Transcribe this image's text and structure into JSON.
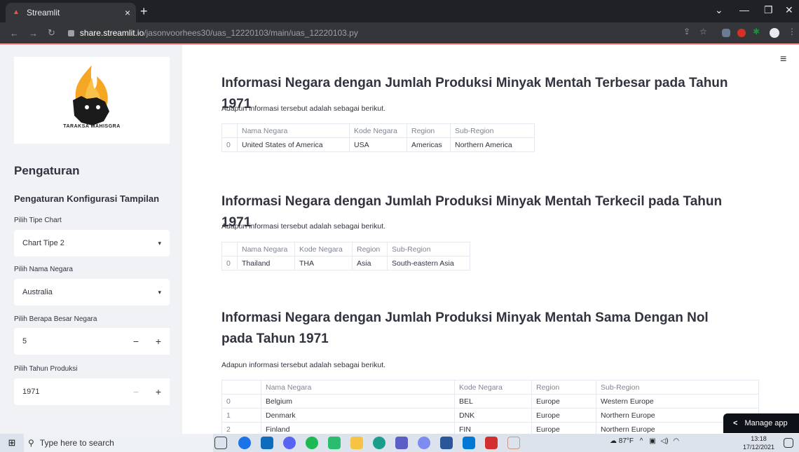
{
  "browser": {
    "tab_title": "Streamlit",
    "tab_close": "×",
    "new_tab": "+",
    "url_host": "share.streamlit.io",
    "url_path": "/jasonvoorhees30/uas_12220103/main/uas_12220103.py",
    "win_min": "—",
    "win_max": "❐",
    "win_close": "✕",
    "win_dropdown": "⌄"
  },
  "sidebar": {
    "logo_caption": "TARAKSA MAHISGRA",
    "heading": "Pengaturan",
    "subheading": "Pengaturan Konfigurasi Tampilan",
    "chart_type": {
      "label": "Pilih Tipe Chart",
      "value": "Chart Tipe 2"
    },
    "country": {
      "label": "Pilih Nama Negara",
      "value": "Australia"
    },
    "size": {
      "label": "Pilih Berapa Besar Negara",
      "value": "5",
      "minus": "−",
      "plus": "+"
    },
    "year": {
      "label": "Pilih Tahun Produksi",
      "value": "1971",
      "minus": "−",
      "plus": "+"
    }
  },
  "main": {
    "sections": [
      {
        "title": "Informasi Negara dengan Jumlah Produksi Minyak Mentah Terbesar pada Tahun 1971",
        "intro": "Adapun informasi tersebut adalah sebagai berikut.",
        "columns": [
          "",
          "Nama Negara",
          "Kode Negara",
          "Region",
          "Sub-Region"
        ],
        "rows": [
          [
            "0",
            "United States of America",
            "USA",
            "Americas",
            "Northern America"
          ]
        ]
      },
      {
        "title": "Informasi Negara dengan Jumlah Produksi Minyak Mentah Terkecil pada Tahun 1971",
        "intro": "Adapun informasi tersebut adalah sebagai berikut.",
        "columns": [
          "",
          "Nama Negara",
          "Kode Negara",
          "Region",
          "Sub-Region"
        ],
        "rows": [
          [
            "0",
            "Thailand",
            "THA",
            "Asia",
            "South-eastern Asia"
          ]
        ]
      },
      {
        "title": "Informasi Negara dengan Jumlah Produksi Minyak Mentah Sama Dengan Nol pada Tahun 1971",
        "intro": "Adapun informasi tersebut adalah sebagai berikut.",
        "columns": [
          "",
          "Nama Negara",
          "Kode Negara",
          "Region",
          "Sub-Region"
        ],
        "rows": [
          [
            "0",
            "Belgium",
            "BEL",
            "Europe",
            "Western Europe"
          ],
          [
            "1",
            "Denmark",
            "DNK",
            "Europe",
            "Northern Europe"
          ],
          [
            "2",
            "Finland",
            "FIN",
            "Europe",
            "Northern Europe"
          ]
        ]
      }
    ],
    "manage_app": "Manage app",
    "manage_chevron": "<"
  },
  "taskbar": {
    "search_placeholder": "Type here to search",
    "weather": "87°F",
    "time": "13:18",
    "date": "17/12/2021"
  },
  "icons": {
    "hamburger": "≡",
    "start": "⊞",
    "search": "⚲",
    "chevron_down": "▾"
  }
}
